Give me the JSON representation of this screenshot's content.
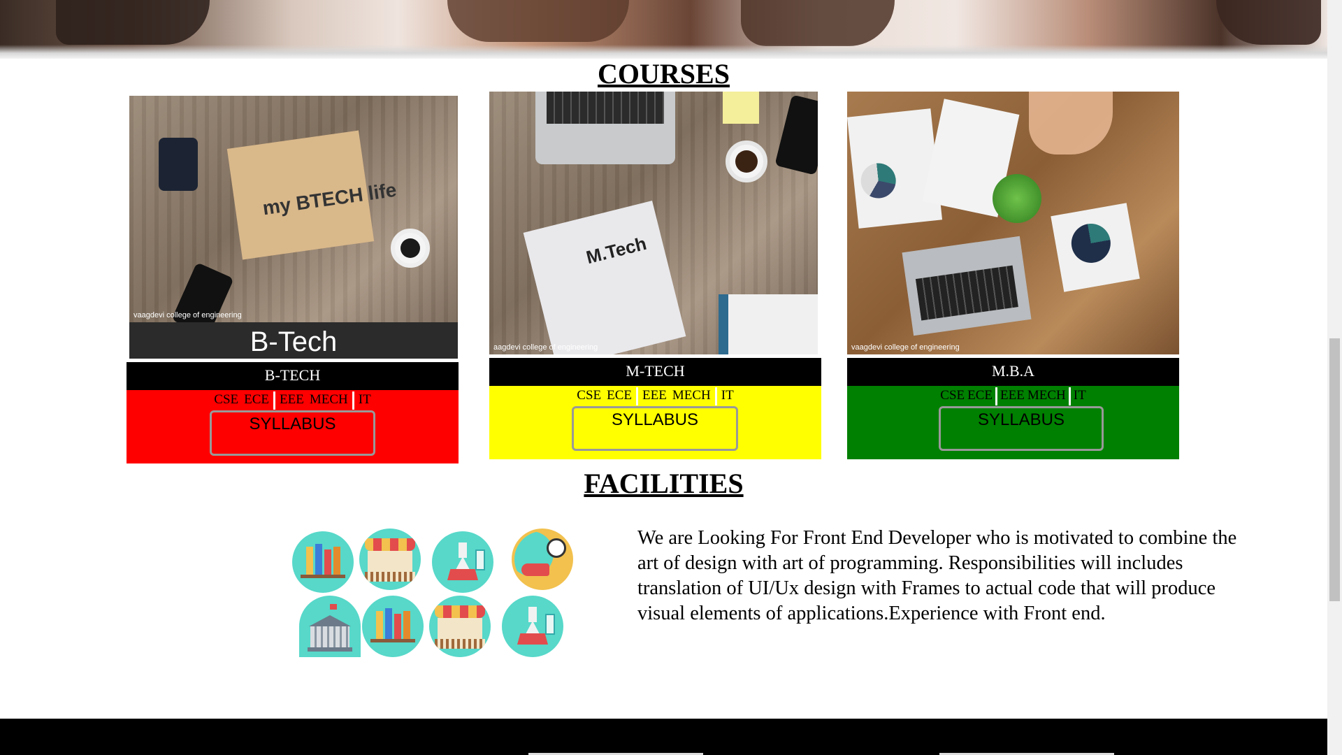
{
  "hero": {
    "description": "hero-banner-photo"
  },
  "courses": {
    "title": "COURSES",
    "cards": [
      {
        "photo_overlay": "B-Tech",
        "photo_hand": "my BTECH life",
        "watermark": "vaagdevi college of engineering",
        "name": "B-TECH",
        "color": "#ff0000",
        "branches": [
          "CSE",
          "ECE",
          "EEE",
          "MECH",
          "IT"
        ],
        "syllabus_label": "SYLLABUS"
      },
      {
        "photo_hand": "M.Tech",
        "watermark": "aagdevi college of engineering",
        "name": "M-TECH",
        "color": "#ffff00",
        "branches": [
          "CSE",
          "ECE",
          "EEE",
          "MECH",
          "IT"
        ],
        "syllabus_label": "SYLLABUS"
      },
      {
        "watermark": "vaagdevi college of engineering",
        "name": "M.B.A",
        "color": "#008000",
        "branches": [
          "CSE",
          "ECE",
          "EEE",
          "MECH",
          "IT"
        ],
        "syllabus_label": "SYLLABUS"
      }
    ]
  },
  "facilities": {
    "title": "FACILITIES",
    "icons": [
      "library-icon",
      "store-icon",
      "lab-icon",
      "sports-icon",
      "college-building-icon",
      "library-icon",
      "store-icon",
      "lab-icon"
    ],
    "text": "We are Looking For Front End Developer who is motivated to combine the art of design with art of programming. Responsibilities will includes translation of UI/Ux design with Frames to actual code that will produce visual elements of applications.Experience with Front end."
  }
}
